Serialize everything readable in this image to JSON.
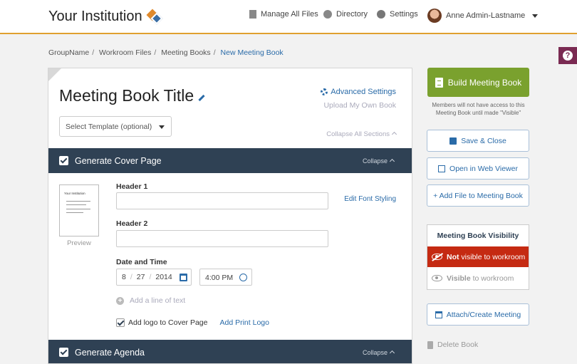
{
  "header": {
    "brand": "Your Institution",
    "nav": [
      "Manage All Files",
      "Directory",
      "Settings"
    ],
    "user": "Anne Admin-Lastname"
  },
  "help": "?",
  "breadcrumb": [
    "GroupName",
    "Workroom Files",
    "Meeting Books",
    "New Meeting Book"
  ],
  "breadcrumb_sep": "/",
  "book": {
    "title": "Meeting Book Title",
    "advanced": "Advanced Settings",
    "upload": "Upload My Own Book",
    "template_placeholder": "Select Template (optional)",
    "collapse_all": "Collapse All Sections"
  },
  "cover": {
    "section_title": "Generate Cover Page",
    "collapse": "Collapse",
    "preview_thumb_text": "Your Institution",
    "preview_label": "Preview",
    "header1_label": "Header 1",
    "header2_label": "Header 2",
    "font_link": "Edit Font Styling",
    "date_label": "Date and Time",
    "date": {
      "month": "8",
      "day": "27",
      "year": "2014"
    },
    "time": "4:00 PM",
    "add_line": "Add a line of text",
    "logo_checkbox": "Add logo to Cover Page",
    "print_logo": "Add Print Logo"
  },
  "agenda": {
    "section_title": "Generate Agenda",
    "collapse": "Collapse"
  },
  "sidebar": {
    "build": "Build Meeting Book",
    "note": "Members will not have access to this Meeting Book until made \"Visible\"",
    "save": "Save & Close",
    "open_web": "Open in Web Viewer",
    "add_file": "+ Add File to Meeting Book",
    "visibility_title": "Meeting Book Visibility",
    "not_visible_bold": "Not",
    "not_visible_rest": "visible to workroom",
    "visible_bold": "Visible",
    "visible_rest": "to workroom",
    "attach": "Attach/Create Meeting",
    "delete": "Delete Book"
  },
  "colors": {
    "accent": "#e0a030",
    "link": "#2a6ba8",
    "section_bar": "#2f4154",
    "build_green": "#7aa12e",
    "not_visible_red": "#c52a12",
    "help_purple": "#7a2a52"
  }
}
